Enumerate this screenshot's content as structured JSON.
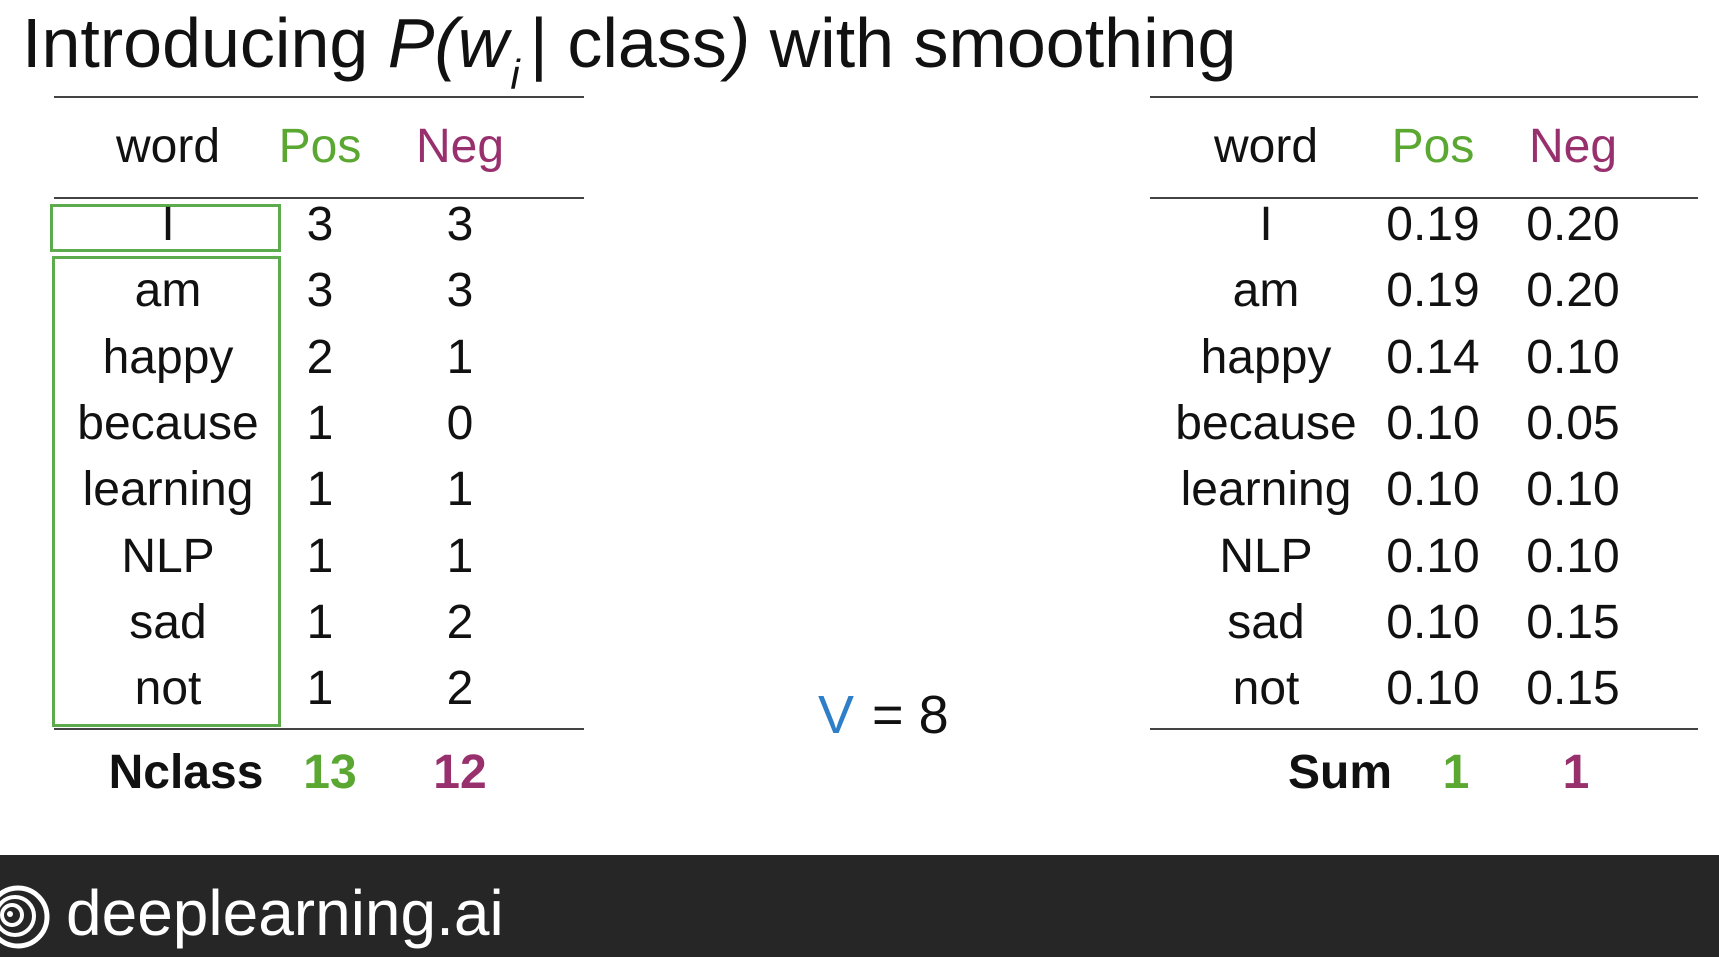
{
  "title": {
    "prefix": "Introducing ",
    "p_open": "P(w",
    "subscript": "i",
    "bar": "| class",
    "p_close": ")",
    "suffix": " with smoothing"
  },
  "counts_table": {
    "headers": [
      "word",
      "Pos",
      "Neg"
    ],
    "rows": [
      [
        "I",
        "3",
        "3"
      ],
      [
        "am",
        "3",
        "3"
      ],
      [
        "happy",
        "2",
        "1"
      ],
      [
        "because",
        "1",
        "0"
      ],
      [
        "learning",
        "1",
        "1"
      ],
      [
        "NLP",
        "1",
        "1"
      ],
      [
        "sad",
        "1",
        "2"
      ],
      [
        "not",
        "1",
        "2"
      ]
    ],
    "footer": [
      "Nclass",
      "13",
      "12"
    ]
  },
  "prob_table": {
    "headers": [
      "word",
      "Pos",
      "Neg"
    ],
    "rows": [
      [
        "I",
        "0.19",
        "0.20"
      ],
      [
        "am",
        "0.19",
        "0.20"
      ],
      [
        "happy",
        "0.14",
        "0.10"
      ],
      [
        "because",
        "0.10",
        "0.05"
      ],
      [
        "learning",
        "0.10",
        "0.10"
      ],
      [
        "NLP",
        "0.10",
        "0.10"
      ],
      [
        "sad",
        "0.10",
        "0.15"
      ],
      [
        "not",
        "0.10",
        "0.15"
      ]
    ],
    "footer": [
      "Sum",
      "1",
      "1"
    ]
  },
  "vocab": {
    "symbol": "V",
    "value": "= 8"
  },
  "footer": {
    "brand": "deeplearning.ai",
    "logo_icon": "deeplearning-logo-icon"
  },
  "colors": {
    "pos": "#5aa832",
    "neg": "#98306e",
    "highlight": "#5cab4c",
    "vocab": "#2f7fc8",
    "footer_bg": "#262626"
  }
}
